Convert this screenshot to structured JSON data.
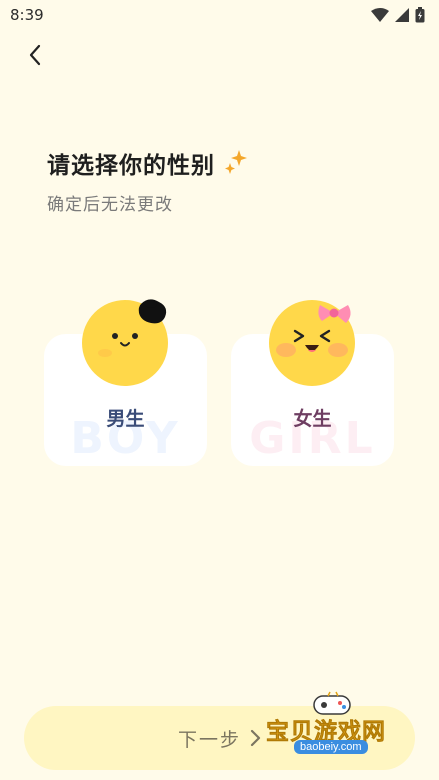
{
  "status_bar": {
    "time": "8:39"
  },
  "header": {
    "title": "请选择你的性别",
    "subtitle": "确定后无法更改"
  },
  "gender_options": [
    {
      "label": "男生",
      "bg_word": "BOY",
      "accent": "#3A4C78"
    },
    {
      "label": "女生",
      "bg_word": "GIRL",
      "accent": "#6E3E62"
    }
  ],
  "footer": {
    "next_label": "下一步"
  },
  "watermark": {
    "text": "宝贝游戏网",
    "url": "baobeiy.com"
  },
  "colors": {
    "background": "#FFFBEA",
    "avatar_yellow": "#FFD84A",
    "sparkle": "#F4A72B"
  }
}
